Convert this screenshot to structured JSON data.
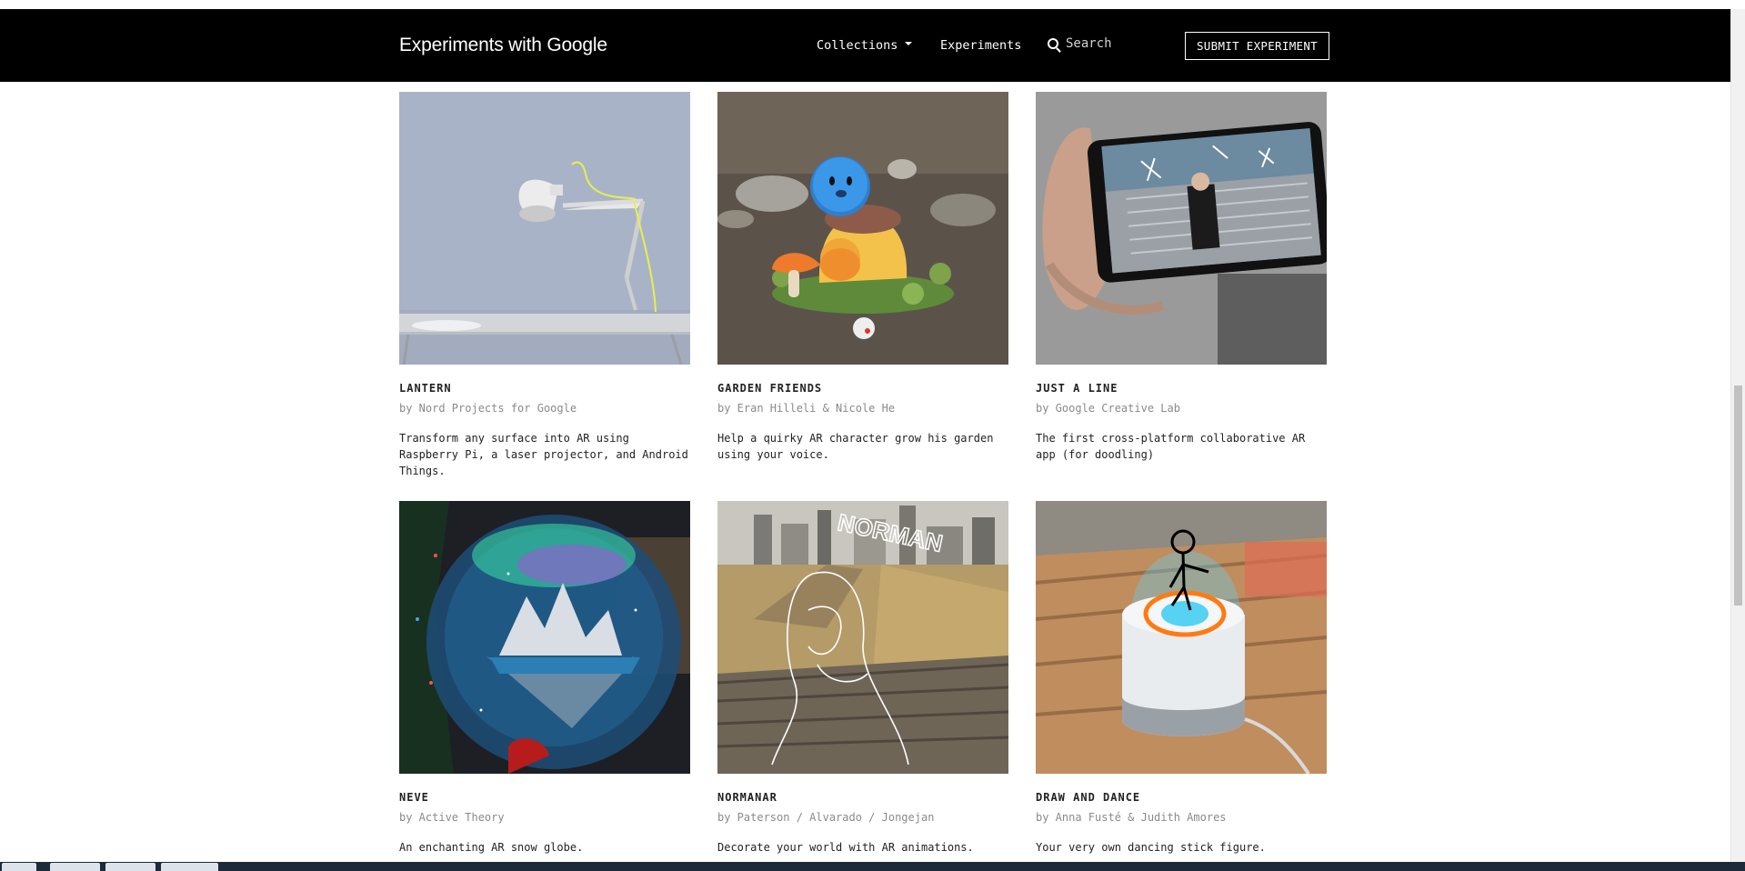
{
  "header": {
    "brand": "Experiments with Google",
    "nav": {
      "collections": "Collections",
      "experiments": "Experiments"
    },
    "search": {
      "label": "Search"
    },
    "submit": "SUBMIT EXPERIMENT"
  },
  "cards": [
    {
      "title": "LANTERN",
      "author": "by Nord Projects for Google",
      "desc": "Transform any surface into AR using Raspberry Pi, a laser projector, and Android Things."
    },
    {
      "title": "GARDEN FRIENDS",
      "author": "by Eran Hilleli & Nicole He",
      "desc": "Help a quirky AR character grow his garden using your voice."
    },
    {
      "title": "JUST A LINE",
      "author": "by Google Creative Lab",
      "desc": "The first cross-platform collaborative AR app (for doodling)"
    },
    {
      "title": "NEVE",
      "author": "by Active Theory",
      "desc": "An enchanting AR snow globe."
    },
    {
      "title": "NORMANAR",
      "author": "by Paterson / Alvarado / Jongejan",
      "desc": "Decorate your world with AR animations."
    },
    {
      "title": "DRAW AND DANCE",
      "author": "by Anna Fusté & Judith Amores",
      "desc": "Your very own dancing stick figure."
    }
  ]
}
